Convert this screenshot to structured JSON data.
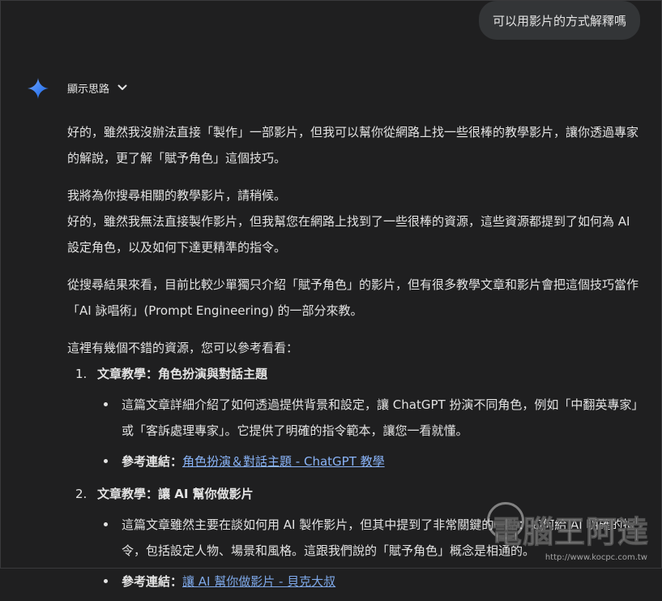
{
  "user_message": "可以用影片的方式解釋嗎",
  "thoughts_toggle": {
    "label": "顯示思路",
    "icon": "chevron-down-icon"
  },
  "assistant_icon": "gemini-sparkle-icon",
  "response": {
    "para1": "好的，雖然我沒辦法直接「製作」一部影片，但我可以幫你從網路上找一些很棒的教學影片，讓你透過專家的解說，更了解「賦予角色」這個技巧。",
    "para2a": "我將為你搜尋相關的教學影片，請稍候。",
    "para2b": "好的，雖然我無法直接製作影片，但我幫您在網路上找到了一些很棒的資源，這些資源都提到了如何為 AI 設定角色，以及如何下達更精準的指令。",
    "para3": "從搜尋結果來看，目前比較少單獨只介紹「賦予角色」的影片，但有很多教學文章和影片會把這個技巧當作「AI 詠唱術」(Prompt Engineering) 的一部分來教。",
    "para4": "這裡有幾個不錯的資源，您可以參考看看：",
    "items": [
      {
        "number": "1.",
        "title": "文章教學：角色扮演與對話主題",
        "desc": "這篇文章詳細介紹了如何透過提供背景和設定，讓 ChatGPT 扮演不同角色，例如「中翻英專家」或「客訴處理專家」。它提供了明確的指令範本，讓您一看就懂。",
        "ref_label": "參考連結：",
        "ref_link": "角色扮演＆對話主題 - ChatGPT 教學"
      },
      {
        "number": "2.",
        "title": "文章教學：讓 AI 幫你做影片",
        "desc": "這篇文章雖然主要在談如何用 AI 製作影片，但其中提到了非常關鍵的一點：如何給 AI 明確的指令，包括設定人物、場景和風格。這跟我們說的「賦予角色」概念是相通的。",
        "ref_label": "參考連結：",
        "ref_link": "讓 AI 幫你做影片 - 貝克大叔"
      }
    ]
  },
  "watermark": {
    "text": "電腦王阿達",
    "url": "http://www.kocpc.com.tw"
  },
  "colors": {
    "background": "#1f1f20",
    "bubble": "#333537",
    "text": "#e3e3e3",
    "link": "#8ab4f8",
    "sparkle_top": "#4285f4",
    "sparkle_bottom": "#1a73e8"
  }
}
